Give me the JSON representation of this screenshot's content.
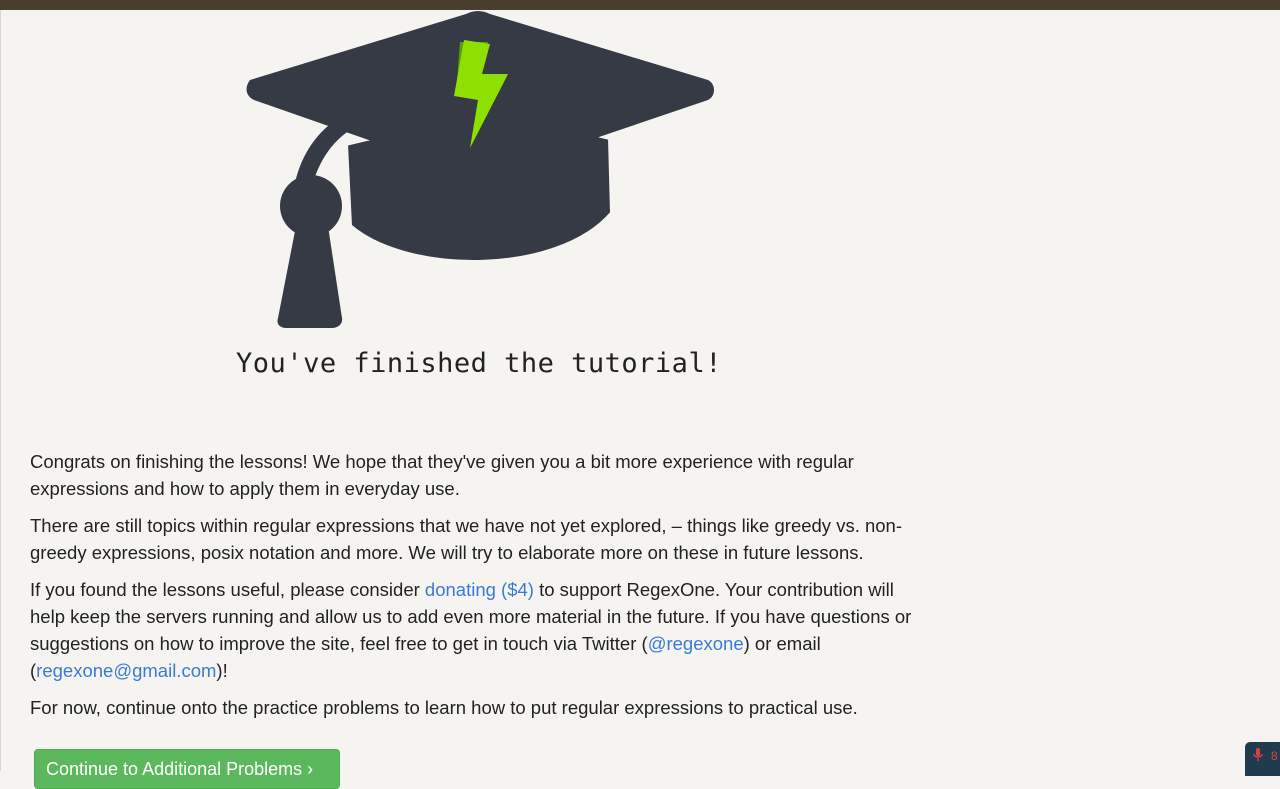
{
  "heading": "You've finished the tutorial!",
  "intro": {
    "p1": "Congrats on finishing the lessons! We hope that they've given you a bit more experience with regular expressions and how to apply them in everyday use.",
    "p2": "There are still topics within regular expressions that we have not yet explored, – things like greedy vs. non-greedy expressions, posix notation and more. We will try to elaborate more on these in future lessons.",
    "p3": {
      "before": "If you found the lessons useful, please consider ",
      "donate_link": "donating ($4)",
      "middle1": " to support RegexOne. Your contribution will help keep the servers running and allow us to add even more material in the future. If you have questions or suggestions on how to improve the site, feel free to get in touch via Twitter (",
      "twitter_link": "@regexone",
      "middle2": ") or email (",
      "email_link": "regexone@gmail.com",
      "after": ")!"
    },
    "p4": "For now, continue onto the practice problems to learn how to put regular expressions to practical use."
  },
  "continue_button": "Continue to Additional Problems ›",
  "widget": {
    "text": "8",
    "icon": "microphone-icon"
  },
  "colors": {
    "topbar": "#4a3f2e",
    "cap": "#353a45",
    "bolt": "#8ee000",
    "link": "#3a7bd5",
    "button": "#5cb85c"
  }
}
